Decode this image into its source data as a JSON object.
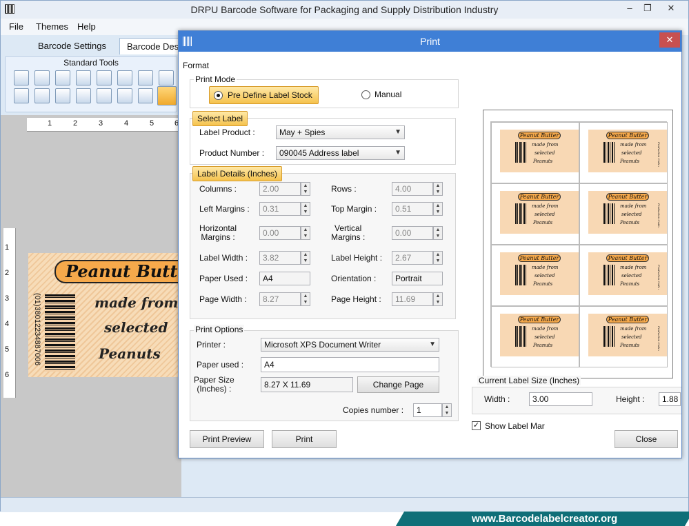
{
  "app": {
    "title": "DRPU Barcode Software for Packaging and Supply Distribution Industry",
    "window_controls": [
      "–",
      "❐",
      "✕"
    ]
  },
  "menu": [
    "File",
    "Themes",
    "Help"
  ],
  "tabs": [
    "Barcode Settings",
    "Barcode Desi"
  ],
  "toolbar": {
    "title": "Standard Tools"
  },
  "ruler": {
    "top": [
      "1",
      "2",
      "3",
      "4",
      "5",
      "6"
    ],
    "left": [
      "1",
      "2",
      "3",
      "4",
      "5",
      "6"
    ]
  },
  "canvas_label": {
    "title": "Peanut Butter",
    "line1": "made from",
    "line2": "selected",
    "line3": "Peanuts",
    "barcode_text": "(01)38012234887006"
  },
  "dialog": {
    "title": "Print",
    "close": "✕",
    "format_label": "Format",
    "print_mode": {
      "label": "Print Mode",
      "predefine": "Pre Define Label Stock",
      "manual": "Manual",
      "selected": "predefine"
    },
    "select_label": {
      "header": "Select Label",
      "product_label": "Label Product :",
      "product_value": "May + Spies",
      "number_label": "Product Number :",
      "number_value": "090045 Address label"
    },
    "label_details": {
      "header": "Label Details (Inches)",
      "columns_label": "Columns :",
      "columns": "2.00",
      "rows_label": "Rows :",
      "rows": "4.00",
      "left_margins_label": "Left Margins :",
      "left_margins": "0.31",
      "top_margin_label": "Top Margin :",
      "top_margin": "0.51",
      "hmargins_label_1": "Horizontal",
      "hmargins_label_2": "Margins :",
      "hmargins": "0.00",
      "vmargins_label_1": "Vertical",
      "vmargins_label_2": "Margins :",
      "vmargins": "0.00",
      "label_width_label": "Label Width :",
      "label_width": "3.82",
      "label_height_label": "Label Height :",
      "label_height": "2.67",
      "paper_used_label": "Paper Used :",
      "paper_used": "A4",
      "orientation_label": "Orientation :",
      "orientation": "Portrait",
      "page_width_label": "Page Width :",
      "page_width": "8.27",
      "page_height_label": "Page Height :",
      "page_height": "11.69"
    },
    "print_options": {
      "label": "Print Options",
      "printer_label": "Printer :",
      "printer": "Microsoft XPS Document Writer",
      "paper_used_label": "Paper used :",
      "paper_used": "A4",
      "paper_size_label_1": "Paper Size",
      "paper_size_label_2": "(Inches) :",
      "paper_size": "8.27 X 11.69",
      "change_page": "Change Page",
      "copies_label": "Copies number :",
      "copies": "1"
    },
    "preview_label": {
      "title": "Peanut Butter",
      "line1": "made from",
      "line2": "selected",
      "line3": "Peanuts",
      "side_text": "Production Code and Best Before"
    },
    "current_size": {
      "label": "Current Label Size (Inches)",
      "width_label": "Width :",
      "width": "3.00",
      "height_label": "Height :",
      "height": "1.88"
    },
    "show_margin": "Show Label Mar",
    "show_margin_checked": true,
    "buttons": {
      "preview": "Print Preview",
      "print": "Print",
      "close": "Close"
    }
  },
  "banner": "www.Barcodelabelcreator.org",
  "colors": {
    "dialog_title_bar": "#3f7fd6",
    "highlight": "#f5c24d",
    "label_orange": "#f6a94b",
    "banner": "#0f6f78"
  }
}
